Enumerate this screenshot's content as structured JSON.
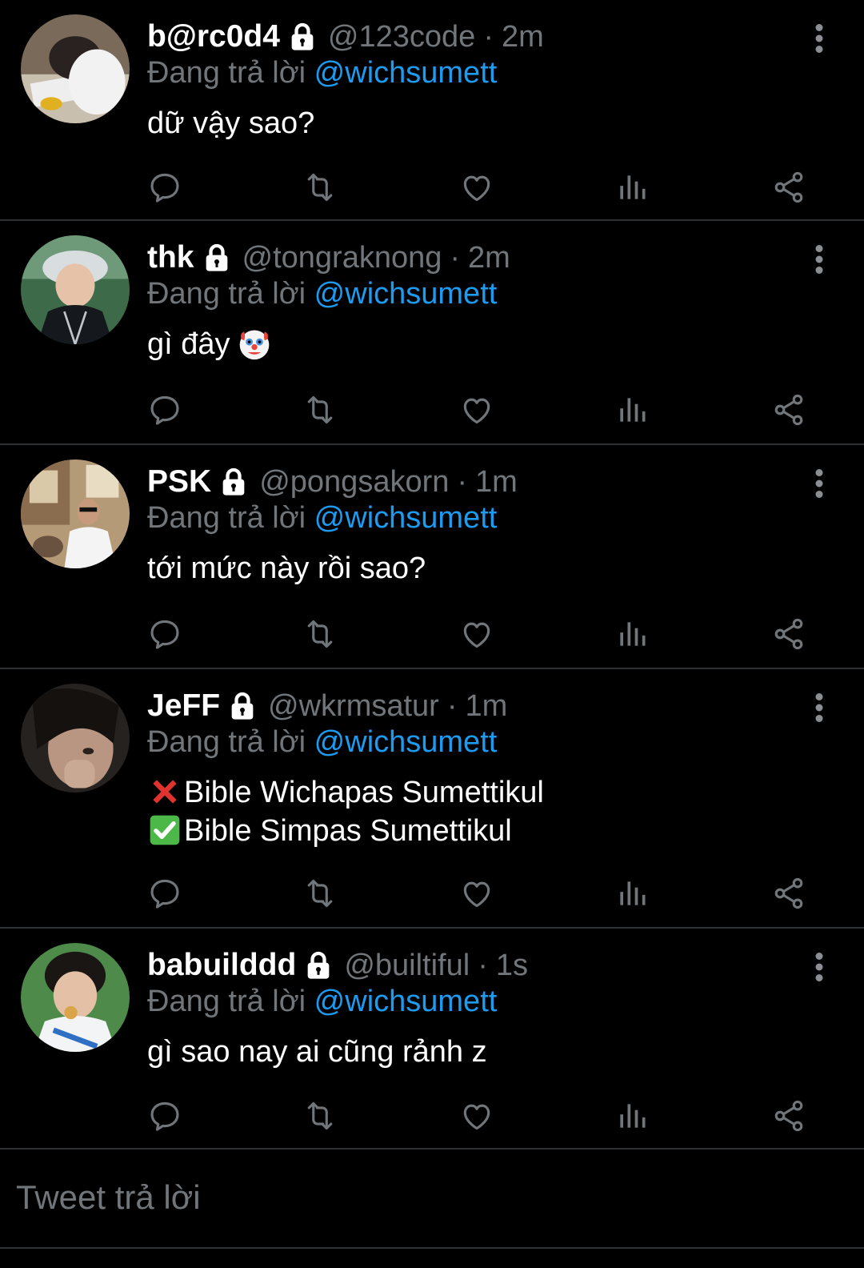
{
  "theme": {
    "background": "#000000",
    "text": "#ffffff",
    "muted": "#71767b",
    "accent": "#1d9bf0",
    "divider": "#2f3336"
  },
  "replies": [
    {
      "display_name": "b@rc0d4",
      "handle": "@123code",
      "separator": "·",
      "time": "2m",
      "replying_prefix": "Đang trả lời",
      "replying_to": "@wichsumett",
      "text": "dữ vậy sao?",
      "icons": [
        "lock-icon",
        "more-vertical-icon"
      ]
    },
    {
      "display_name": "thk",
      "handle": "@tongraknong",
      "separator": "·",
      "time": "2m",
      "replying_prefix": "Đang trả lời",
      "replying_to": "@wichsumett",
      "text": "gì đây",
      "emoji": "clown-face-emoji",
      "icons": [
        "lock-icon",
        "more-vertical-icon"
      ]
    },
    {
      "display_name": "PSK",
      "handle": "@pongsakorn",
      "separator": "·",
      "time": "1m",
      "replying_prefix": "Đang trả lời",
      "replying_to": "@wichsumett",
      "text": "tới mức này rồi sao?",
      "icons": [
        "lock-icon",
        "more-vertical-icon"
      ]
    },
    {
      "display_name": "JeFF",
      "handle": "@wkrmsatur",
      "separator": "·",
      "time": "1m",
      "replying_prefix": "Đang trả lời",
      "replying_to": "@wichsumett",
      "text_lines": [
        "Bible Wichapas Sumettikul",
        "Bible Simpas Sumettikul"
      ],
      "line_emojis": [
        "cross-mark-emoji",
        "check-mark-emoji"
      ],
      "icons": [
        "lock-icon",
        "more-vertical-icon"
      ]
    },
    {
      "display_name": "babuilddd",
      "handle": "@builtiful",
      "separator": "·",
      "time": "1s",
      "replying_prefix": "Đang trả lời",
      "replying_to": "@wichsumett",
      "text": "gì sao nay ai cũng rảnh z",
      "icons": [
        "lock-icon",
        "more-vertical-icon"
      ]
    }
  ],
  "action_icons": [
    "reply-icon",
    "retweet-icon",
    "like-icon",
    "views-icon",
    "share-icon"
  ],
  "composer": {
    "placeholder": "Tweet trả lời"
  }
}
